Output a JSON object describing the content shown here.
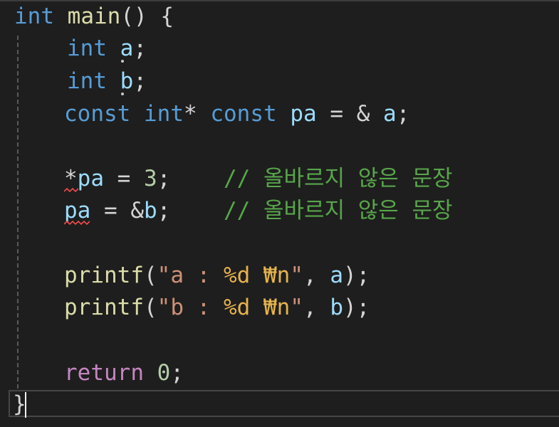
{
  "code": {
    "line1": {
      "type": "int",
      "name": "main",
      "parens": "()",
      "brace": "{"
    },
    "line2": {
      "type": "int",
      "var": "a",
      "semi": ";"
    },
    "line3": {
      "type": "int",
      "var": "b",
      "semi": ";"
    },
    "line4": {
      "const1": "const",
      "type": "int",
      "star": "*",
      "const2": "const",
      "var": "pa",
      "eq": "=",
      "amp": "&",
      "target": "a",
      "semi": ";"
    },
    "line6": {
      "star": "*",
      "var": "pa",
      "eq": "=",
      "value": "3",
      "semi": ";",
      "comment": "// 올바르지 않은 문장"
    },
    "line7": {
      "var": "pa",
      "eq": "=",
      "amp": "&",
      "target": "b",
      "semi": ";",
      "comment": "// 올바르지 않은 문장"
    },
    "line9": {
      "fn": "printf",
      "open": "(",
      "str_a": "\"a : ",
      "fmt": "%d ₩n",
      "str_b": "\"",
      "comma": ",",
      "arg": "a",
      "close": ");"
    },
    "line10": {
      "fn": "printf",
      "open": "(",
      "str_a": "\"b : ",
      "fmt": "%d ₩n",
      "str_b": "\"",
      "comma": ",",
      "arg": "b",
      "close": ");"
    },
    "line12": {
      "kw": "return",
      "value": "0",
      "semi": ";"
    },
    "line13": {
      "brace": "}"
    }
  },
  "colors": {
    "background": "#1e1e1e",
    "keyword": "#569cd6",
    "control": "#c586c0",
    "function": "#dcdcaa",
    "variable": "#9cdcfe",
    "number": "#b5cea8",
    "string": "#ce9178",
    "format": "#e6b34c",
    "comment": "#57a64a",
    "error_squiggle": "#f14c4c"
  }
}
